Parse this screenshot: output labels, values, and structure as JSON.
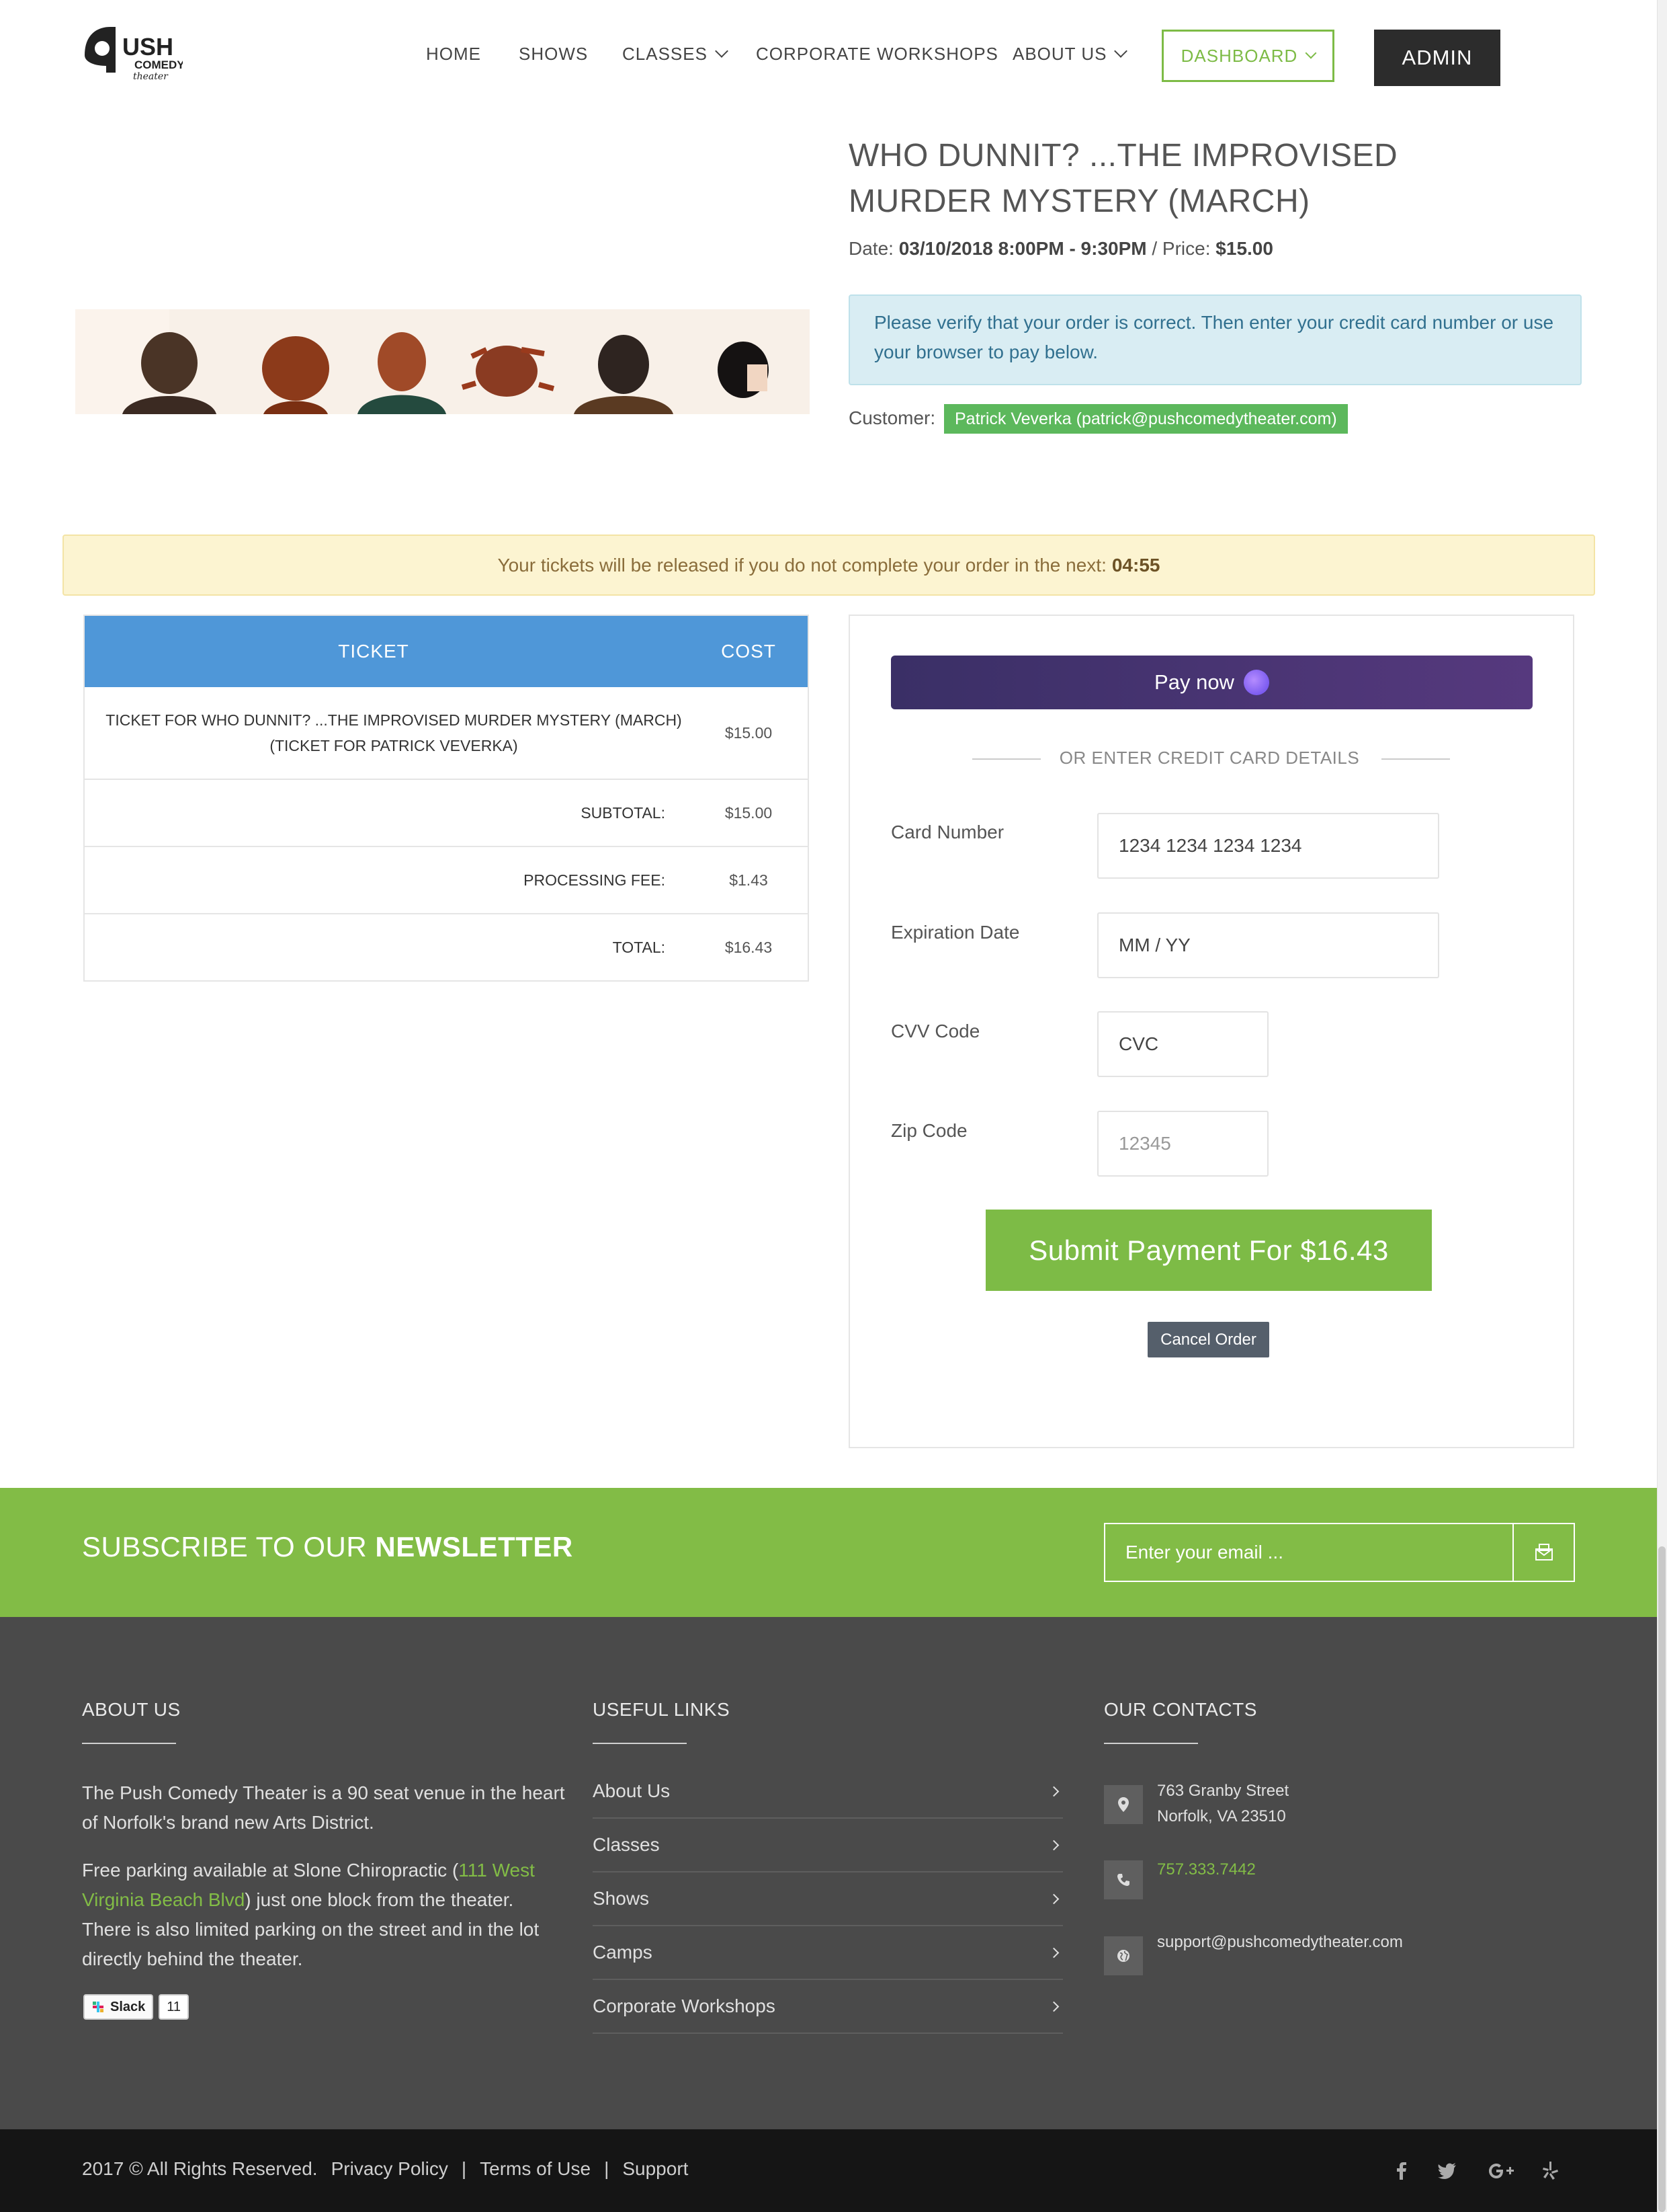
{
  "header": {
    "logo": {
      "word1": "USH",
      "word2": "COMEDY",
      "word3": "theater"
    },
    "nav": {
      "home": "HOME",
      "shows": "SHOWS",
      "classes": "CLASSES",
      "corporate": "CORPORATE WORKSHOPS",
      "about": "ABOUT US"
    },
    "dashboard": "DASHBOARD",
    "admin": "ADMIN"
  },
  "event": {
    "title": "WHO DUNNIT? ...THE IMPROVISED MURDER MYSTERY (MARCH)",
    "date_label": "Date: ",
    "date_value": "03/10/2018 8:00PM - 9:30PM",
    "price_label": " / Price: ",
    "price_value": "$15.00",
    "verify_text": "Please verify that your order is correct. Then enter your credit card number or use your browser to pay below.",
    "customer_label": "Customer:",
    "customer_value": "Patrick Veverka (patrick@pushcomedytheater.com)"
  },
  "timer": {
    "text": "Your tickets will be released if you do not complete your order in the next:",
    "value": "04:55"
  },
  "ticket_table": {
    "headers": {
      "ticket": "TICKET",
      "cost": "COST"
    },
    "item": {
      "line1": "TICKET FOR WHO DUNNIT? ...THE IMPROVISED MURDER MYSTERY (MARCH)",
      "line2": "(TICKET FOR PATRICK VEVERKA)",
      "cost": "$15.00"
    },
    "subtotal": {
      "label": "SUBTOTAL:",
      "value": "$15.00"
    },
    "fee": {
      "label": "PROCESSING FEE:",
      "value": "$1.43"
    },
    "total": {
      "label": "TOTAL:",
      "value": "$16.43"
    }
  },
  "payment": {
    "pay_now": "Pay now",
    "or_text": "OR ENTER CREDIT CARD DETAILS",
    "card_number_label": "Card Number",
    "card_number_placeholder": "1234 1234 1234 1234",
    "expiration_label": "Expiration Date",
    "expiration_placeholder": "MM / YY",
    "cvv_label": "CVV Code",
    "cvv_placeholder": "CVC",
    "zip_label": "Zip Code",
    "zip_placeholder": "12345",
    "submit": "Submit Payment For $16.43",
    "cancel": "Cancel Order"
  },
  "newsletter": {
    "title_light": "SUBSCRIBE TO OUR ",
    "title_bold": "NEWSLETTER",
    "placeholder": "Enter your email ..."
  },
  "footer": {
    "about": {
      "heading": "ABOUT US",
      "p1": "The Push Comedy Theater is a 90 seat venue in the heart of Norfolk's brand new Arts District.",
      "p2_start": "Free parking available at Slone Chiropractic (",
      "p2_link": "111 West Virginia Beach Blvd",
      "p2_end": ") just one block from the theater. There is also limited parking on the street and in the lot directly behind the theater.",
      "slack_label": "Slack",
      "slack_count": "11"
    },
    "links": {
      "heading": "USEFUL LINKS",
      "items": [
        "About Us",
        "Classes",
        "Shows",
        "Camps",
        "Corporate Workshops"
      ]
    },
    "contacts": {
      "heading": "OUR CONTACTS",
      "address1": "763 Granby Street",
      "address2": "Norfolk, VA 23510",
      "phone": "757.333.7442",
      "email": "support@pushcomedytheater.com"
    }
  },
  "bottom": {
    "copyright": "2017 © All Rights Reserved.",
    "privacy": "Privacy Policy",
    "sep": "|",
    "terms": "Terms of Use",
    "support": "Support",
    "social_icons": [
      "facebook-icon",
      "twitter-icon",
      "google-plus-icon",
      "yelp-icon"
    ]
  }
}
